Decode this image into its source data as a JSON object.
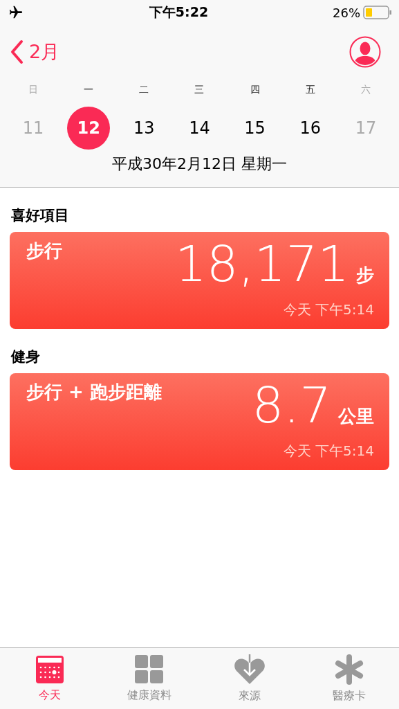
{
  "status_bar": {
    "time": "下午5:22",
    "battery": "26%"
  },
  "nav": {
    "back": "2月"
  },
  "week": {
    "days": [
      {
        "weekday": "日",
        "date": "11",
        "selected": false,
        "dimmed": true
      },
      {
        "weekday": "一",
        "date": "12",
        "selected": true,
        "dimmed": false
      },
      {
        "weekday": "二",
        "date": "13",
        "selected": false,
        "dimmed": false
      },
      {
        "weekday": "三",
        "date": "14",
        "selected": false,
        "dimmed": false
      },
      {
        "weekday": "四",
        "date": "15",
        "selected": false,
        "dimmed": false
      },
      {
        "weekday": "五",
        "date": "16",
        "selected": false,
        "dimmed": false
      },
      {
        "weekday": "六",
        "date": "17",
        "selected": false,
        "dimmed": true
      }
    ],
    "full_date": "平成30年2月12日 星期一"
  },
  "sections": [
    {
      "title": "喜好項目",
      "card": {
        "label": "步行",
        "value": "18,171",
        "unit": "步",
        "time": "今天 下午5:14"
      }
    },
    {
      "title": "健身",
      "card": {
        "label": "步行 + 跑步距離",
        "value": "8.7",
        "unit": "公里",
        "time": "今天 下午5:14"
      }
    }
  ],
  "tab_bar": [
    {
      "kind": "today",
      "label": "今天",
      "selected": true
    },
    {
      "kind": "data",
      "label": "健康資料",
      "selected": false
    },
    {
      "kind": "sources",
      "label": "來源",
      "selected": false
    },
    {
      "kind": "medical",
      "label": "醫療卡",
      "selected": false
    }
  ]
}
